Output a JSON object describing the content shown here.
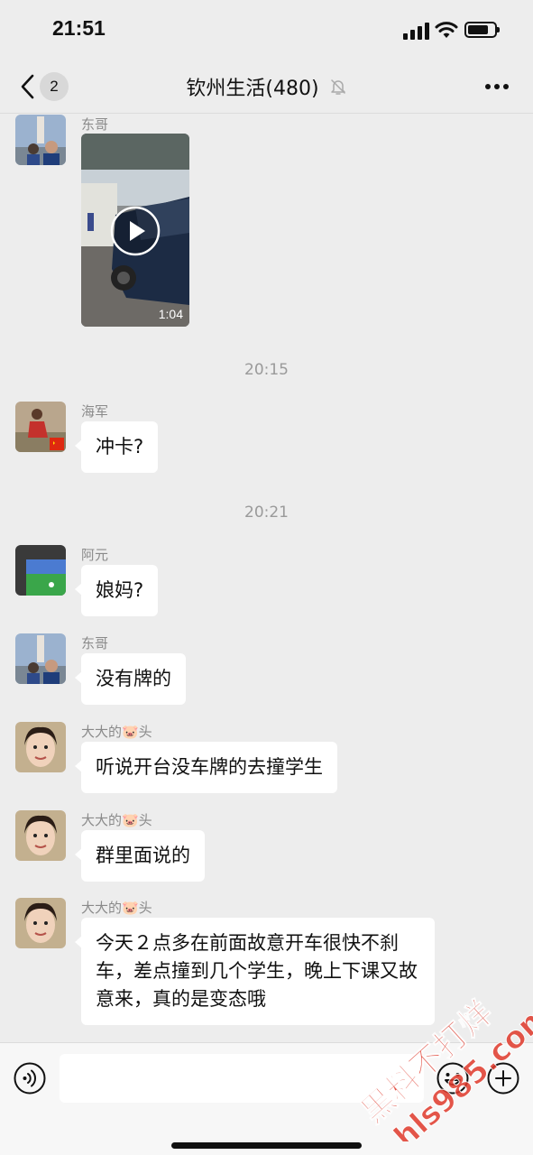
{
  "status_bar": {
    "time": "21:51",
    "battery_level": 0.8
  },
  "nav": {
    "back_badge": "2",
    "title": "钦州生活(480)",
    "icons": [
      "back-icon",
      "mute-icon",
      "more-icon"
    ]
  },
  "messages": [
    {
      "type": "video",
      "sender": "东哥",
      "duration": "1:04"
    },
    {
      "type": "time",
      "text": "20:15"
    },
    {
      "type": "text",
      "sender": "海军",
      "text": "冲卡?"
    },
    {
      "type": "time",
      "text": "20:21"
    },
    {
      "type": "text",
      "sender": "阿元",
      "text": "娘妈?"
    },
    {
      "type": "text",
      "sender": "东哥",
      "text": "没有牌的"
    },
    {
      "type": "text",
      "sender": "大大的🐷头",
      "text": "听说开台没车牌的去撞学生"
    },
    {
      "type": "text",
      "sender": "大大的🐷头",
      "text": "群里面说的"
    },
    {
      "type": "text",
      "sender": "大大的🐷头",
      "text": "今天２点多在前面故意开车很快不刹车，差点撞到几个学生，晚上下课又故意来，真的是变态哦"
    }
  ],
  "input_bar": {
    "icons": [
      "voice-icon",
      "emoji-icon",
      "plus-icon"
    ]
  },
  "watermark": {
    "text": "黑料不打烊",
    "url": "hls985.com",
    "color": "#e0392b"
  },
  "colors": {
    "background": "#ededed",
    "bubble": "#ffffff",
    "meta_text": "#8a8a8a"
  }
}
